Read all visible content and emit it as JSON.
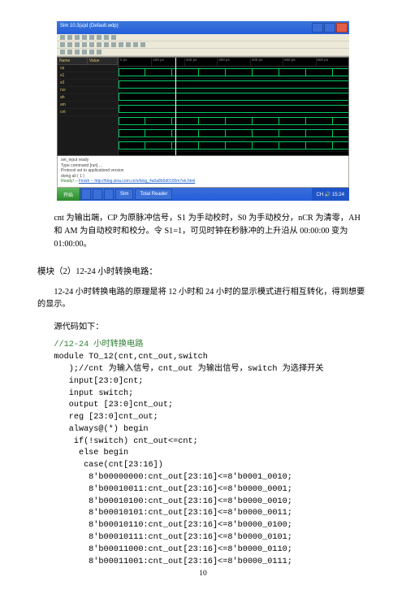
{
  "screenshot": {
    "title": "Sim 10.3(a)d   (Default.wdp)",
    "side": {
      "col1": "Name",
      "col2": "Value",
      "rows": [
        "cp",
        "s1",
        "s0",
        "ncr",
        "ah",
        "am",
        "cnt"
      ]
    },
    "ruler": [
      "0 ps",
      "100 ps",
      "200 ps",
      "300 ps",
      "400 ps",
      "500 ps",
      "600 ps"
    ],
    "bottom": [
      "set_input ready",
      "Type command [run] ...",
      "Protocol set to applicationd version",
      "doing all ( 1 )",
      "Finish -- http://blog.sina.com.cn/s/blog_4a0a8b5d0100m7ek.html"
    ],
    "taskbar": {
      "start": "开始",
      "items": [
        "",
        "",
        "",
        "Sim",
        "Total Reader"
      ],
      "tray": "CH 🔊 15:24"
    }
  },
  "para1": "cnt 为输出端，CP 为原脉冲信号，S1 为手动校时，S0 为手动校分，nCR 为清零，AH 和 AM 为自动校时和校分。令 S1=1，可见时钟在秒脉冲的上升沿从 00:00:00 变为 01:00:00。",
  "sectionTitle": "模块（2）12-24 小时转换电路：",
  "sectionDesc": "12-24 小时转换电路的原理是将 12 小时和 24 小时的显示模式进行相互转化，得到想要的显示。",
  "srcLabel": "源代码如下：",
  "code": {
    "c1": "//12-24 小时转换电路",
    "l1": "module TO_12(cnt,cnt_out,switch",
    "l2": "   );//cnt 为输入信号，cnt_out 为输出信号，switch 为选择开关",
    "l3": "   input[23:0]cnt;",
    "l4": "   input switch;",
    "l5": "   output [23:0]cnt_out;",
    "l6": "   reg [23:0]cnt_out;",
    "l7": "   always@(*) begin",
    "l8": "    if(!switch) cnt_out<=cnt;",
    "l9": "     else begin",
    "l10": "      case(cnt[23:16])",
    "l11": "       8'b00000000:cnt_out[23:16]<=8'b0001_0010;",
    "l12": "       8'b00010011:cnt_out[23:16]<=8'b0000_0001;",
    "l13": "       8'b00010100:cnt_out[23:16]<=8'b0000_0010;",
    "l14": "       8'b00010101:cnt_out[23:16]<=8'b0000_0011;",
    "l15": "       8'b00010110:cnt_out[23:16]<=8'b0000_0100;",
    "l16": "       8'b00010111:cnt_out[23:16]<=8'b0000_0101;",
    "l17": "       8'b00011000:cnt_out[23:16]<=8'b0000_0110;",
    "l18": "       8'b00011001:cnt_out[23:16]<=8'b0000_0111;"
  },
  "pageNum": "10"
}
